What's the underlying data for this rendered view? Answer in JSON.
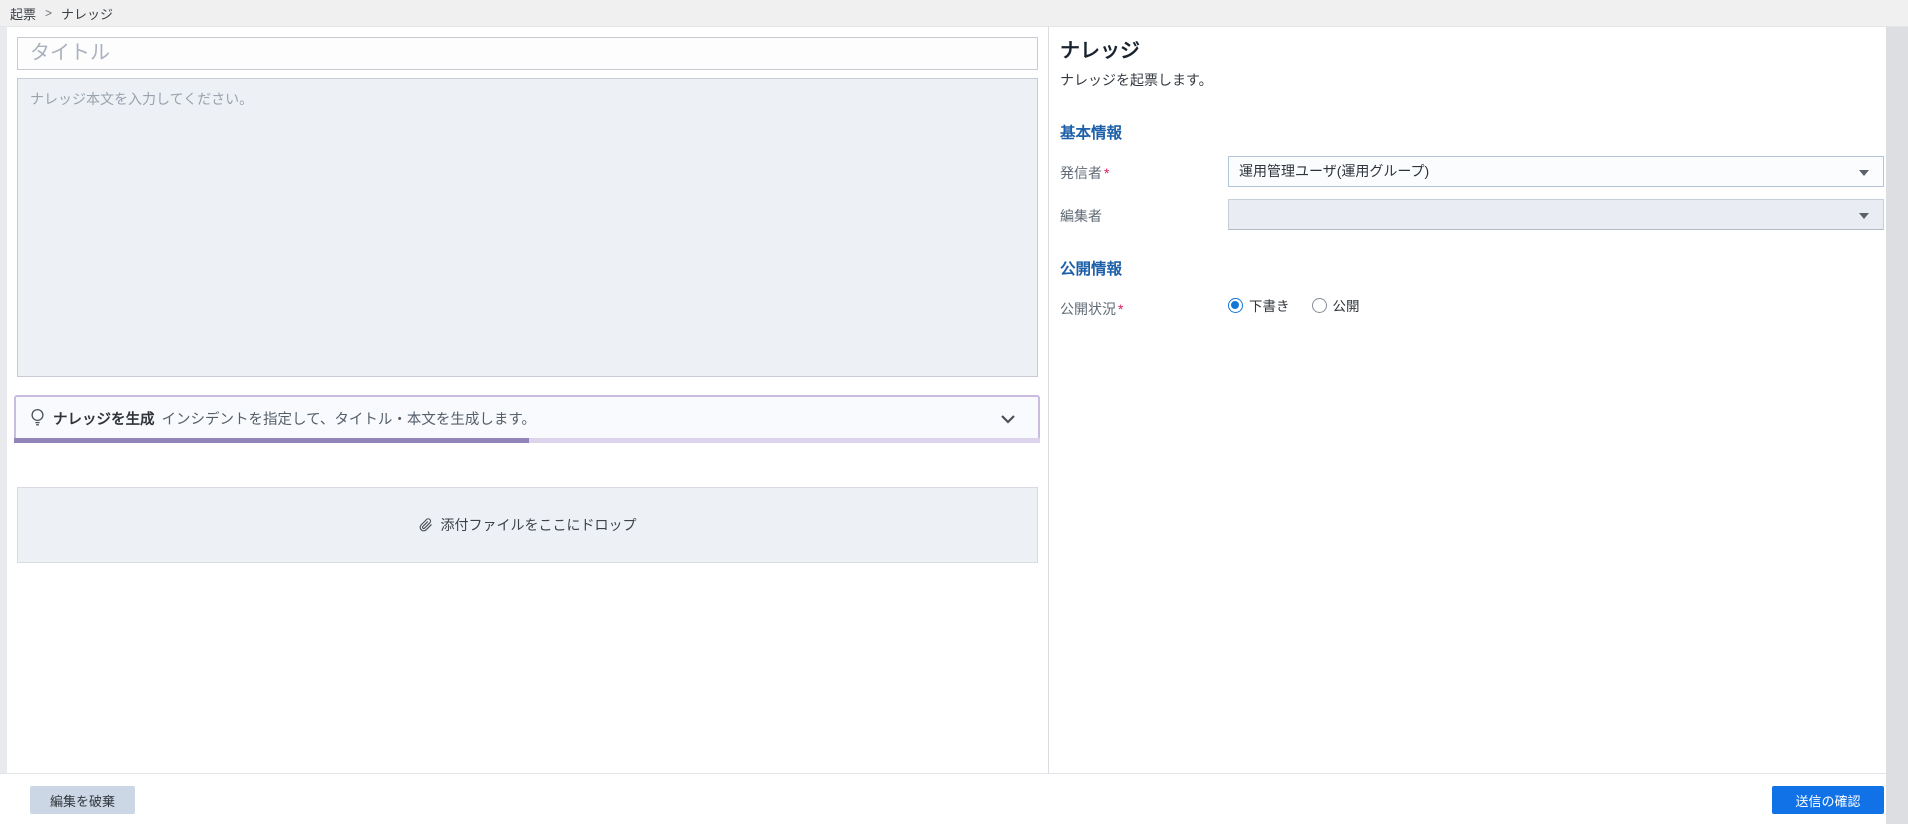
{
  "breadcrumb": {
    "item1": "起票",
    "separator": ">",
    "item2": "ナレッジ"
  },
  "composer": {
    "title_placeholder": "タイトル",
    "body_placeholder": "ナレッジ本文を入力してください。",
    "generate_title": "ナレッジを生成",
    "generate_description": "インシデントを指定して、タイトル・本文を生成します。",
    "dropzone_label": "添付ファイルをここにドロップ"
  },
  "details": {
    "heading": "ナレッジ",
    "description": "ナレッジを起票します。",
    "basic_section_heading": "基本情報",
    "sender_label": "発信者",
    "sender_required": "*",
    "sender_value": "運用管理ユーザ(運用グループ)",
    "editor_label": "編集者",
    "editor_value": "",
    "publish_section_heading": "公開情報",
    "status_label": "公開状況",
    "status_required": "*",
    "status_option_draft": "下書き",
    "status_option_public": "公開",
    "status_selected": "下書き"
  },
  "footer": {
    "discard_label": "編集を破棄",
    "submit_label": "送信の確認"
  },
  "icons": {
    "generate": "lightbulb-icon",
    "generate_expand": "chevron-down-icon",
    "attachment": "paperclip-icon",
    "selects": "caret-down-icon"
  },
  "colors": {
    "submit_blue": "#1172e8",
    "section_heading_blue": "#1d5fa8",
    "required_red": "#d61a5e",
    "radio_selected_blue": "#1276d8",
    "generate_border_purple": "#c9bddf",
    "generate_progress_dark": "#9184ba",
    "generate_progress_light": "#ddd3ec",
    "panel_field_gray": "#edf0f5"
  }
}
